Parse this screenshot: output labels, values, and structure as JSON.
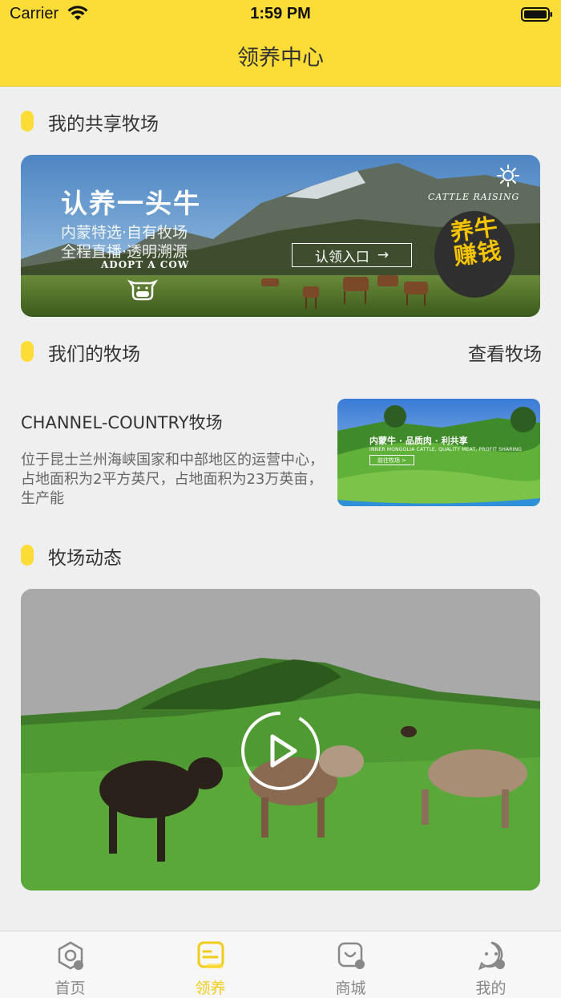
{
  "status_bar": {
    "carrier": "Carrier",
    "time": "1:59 PM"
  },
  "nav": {
    "title": "领养中心"
  },
  "sections": {
    "shared_ranch": {
      "title": "我的共享牧场"
    },
    "our_ranch": {
      "title": "我们的牧场",
      "link": "查看牧场"
    },
    "news": {
      "title": "牧场动态"
    }
  },
  "banner": {
    "headline": "认养一头牛",
    "line1": "内蒙特选·自有牧场",
    "line2": "全程直播·透明溯源",
    "sub": "ADOPT A COW",
    "cattle_text": "CATTLE RAISING",
    "cta": "认领入口",
    "seal_text": "养牛赚钱"
  },
  "ranch": {
    "name": "CHANNEL-COUNTRY牧场",
    "description": "位于昆士兰州海峡国家和中部地区的运营中心，占地面积为2平方英尺，占地面积为23万英亩，生产能",
    "thumb_title": "内蒙牛 · 品质肉 · 利共享",
    "thumb_sub": "INNER MONGOLIA CATTLE, QUALITY MEAT, PROFIT SHARING",
    "thumb_button": "前往牧场 >"
  },
  "tabs": [
    {
      "label": "首页",
      "icon": "home-icon",
      "active": false
    },
    {
      "label": "领养",
      "icon": "adopt-icon",
      "active": true
    },
    {
      "label": "商城",
      "icon": "shop-icon",
      "active": false
    },
    {
      "label": "我的",
      "icon": "profile-icon",
      "active": false
    }
  ],
  "colors": {
    "brand_yellow": "#fcdc36",
    "active_tab": "#f2cc1a",
    "background": "#efefef"
  }
}
